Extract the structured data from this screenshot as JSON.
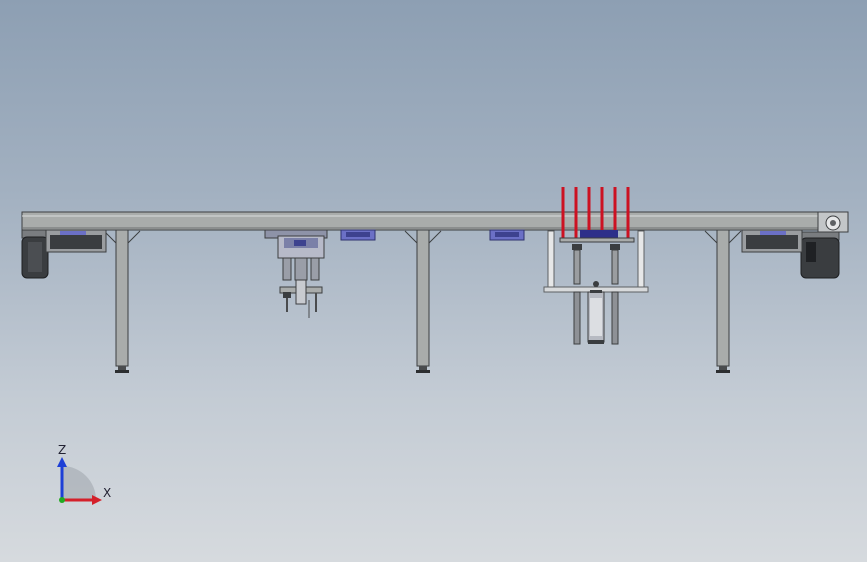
{
  "view": {
    "background_top": "#8d9fb3",
    "background_bottom": "#d6dade"
  },
  "model": {
    "frame_color": "#a9acab",
    "frame_outline": "#3c3e40",
    "motor_color": "#3a3d40",
    "bracket_color": "#6b70c6",
    "rod_color": "#cc1122",
    "cylinder_color": "#8e93a8"
  },
  "triad": {
    "z_label": "Z",
    "x_label": "X",
    "z_color": "#1d3fd6",
    "x_color": "#d4202a",
    "y_color": "#22aa22"
  }
}
